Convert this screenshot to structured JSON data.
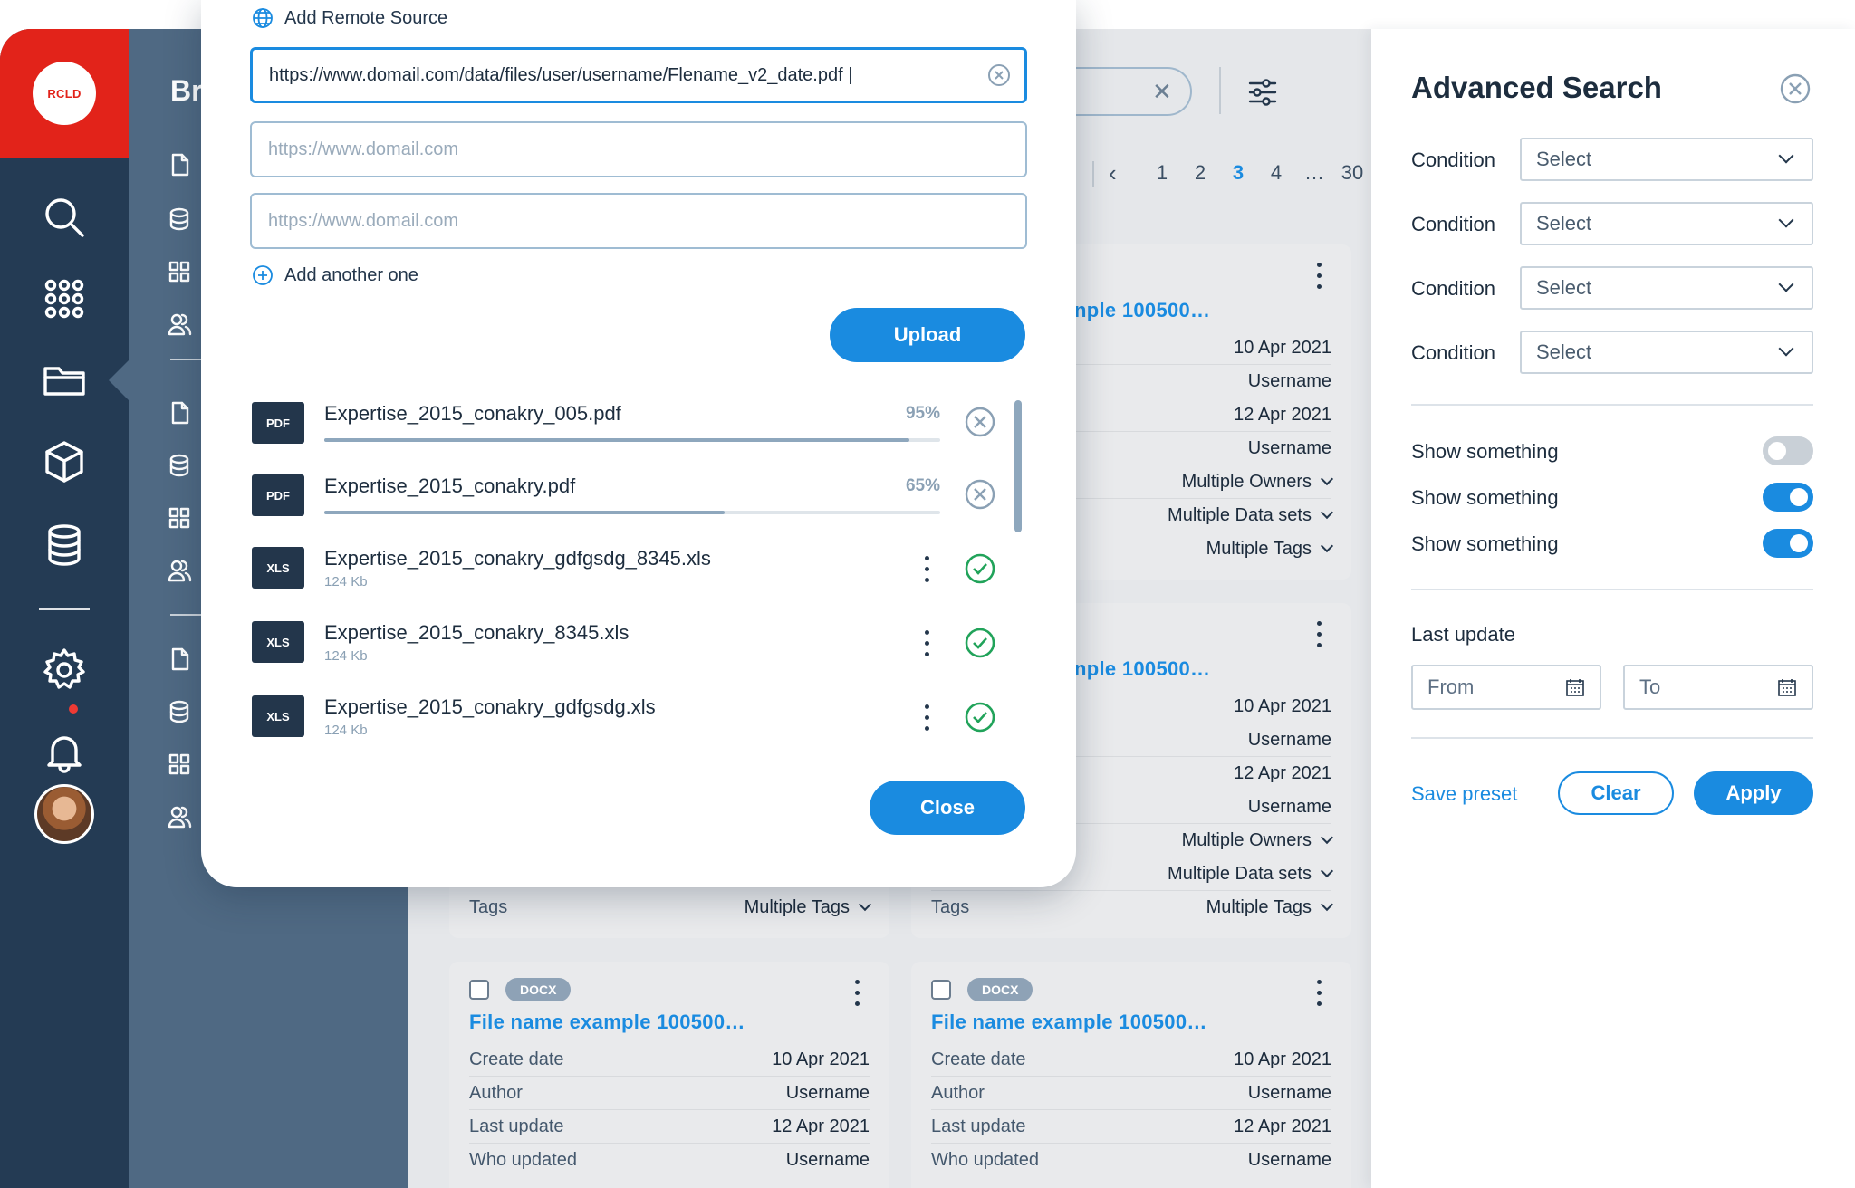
{
  "rail": {
    "logo": "RCLD",
    "items": [
      "search-icon",
      "apps-grid-icon",
      "folder-icon",
      "cube-icon",
      "database-icon",
      "settings-icon",
      "bell-icon"
    ]
  },
  "sidebar": {
    "title": "Br"
  },
  "toolbar": {
    "pager": {
      "pages": [
        "1",
        "2",
        "3",
        "4",
        "…",
        "30"
      ],
      "current": "3"
    }
  },
  "cards": [
    {
      "title_partial": "nple 100500…",
      "rows": [
        {
          "key": "",
          "value": "10 Apr 2021"
        },
        {
          "key": "",
          "value": "Username"
        },
        {
          "key": "",
          "value": "12 Apr 2021"
        },
        {
          "key": "",
          "value": "Username"
        },
        {
          "key": "",
          "value": "Multiple Owners"
        },
        {
          "key": "",
          "value": "Multiple Data sets"
        },
        {
          "key": "",
          "value": "Multiple Tags"
        }
      ]
    },
    {
      "title_partial": "nple 100500…",
      "rows": [
        {
          "key": "",
          "value": "10 Apr 2021"
        },
        {
          "key": "",
          "value": "Username"
        },
        {
          "key": "",
          "value": "12 Apr 2021"
        },
        {
          "key": "",
          "value": "Username"
        },
        {
          "key": "",
          "value": "Multiple Owners"
        },
        {
          "key": "",
          "value": "Multiple Data sets"
        },
        {
          "key": "Tags",
          "value": "Multiple Tags"
        }
      ]
    },
    {
      "tags_row": {
        "key": "Tags",
        "value": "Multiple Tags"
      }
    },
    {
      "badge": "DOCX",
      "title": "File name example 100500…",
      "rows": [
        {
          "key": "Create date",
          "value": "10 Apr 2021"
        },
        {
          "key": "Author",
          "value": "Username"
        },
        {
          "key": "Last update",
          "value": "12 Apr 2021"
        },
        {
          "key": "Who updated",
          "value": "Username"
        }
      ]
    },
    {
      "badge": "DOCX",
      "title": "File name example 100500…",
      "rows": [
        {
          "key": "Create date",
          "value": "10 Apr 2021"
        },
        {
          "key": "Author",
          "value": "Username"
        },
        {
          "key": "Last update",
          "value": "12 Apr 2021"
        },
        {
          "key": "Who updated",
          "value": "Username"
        }
      ]
    }
  ],
  "modal": {
    "add_remote_label": "Add Remote Source",
    "url_1_value": "https://www.domail.com/data/files/user/username/Flename_v2_date.pdf |",
    "url_placeholder": "https://www.domail.com",
    "add_another_label": "Add another one",
    "upload_label": "Upload",
    "close_label": "Close",
    "files": [
      {
        "type": "PDF",
        "name": "Expertise_2015_conakry_005.pdf",
        "progress": 95,
        "progress_label": "95%",
        "status": "uploading"
      },
      {
        "type": "PDF",
        "name": "Expertise_2015_conakry.pdf",
        "progress": 65,
        "progress_label": "65%",
        "status": "uploading"
      },
      {
        "type": "XLS",
        "name": "Expertise_2015_conakry_gdfgsdg_8345.xls",
        "size": "124 Kb",
        "status": "done"
      },
      {
        "type": "XLS",
        "name": "Expertise_2015_conakry_8345.xls",
        "size": "124 Kb",
        "status": "done"
      },
      {
        "type": "XLS",
        "name": "Expertise_2015_conakry_gdfgsdg.xls",
        "size": "124 Kb",
        "status": "done"
      }
    ]
  },
  "advanced_search": {
    "title": "Advanced Search",
    "conditions": [
      {
        "label": "Condition",
        "value": "Select"
      },
      {
        "label": "Condition",
        "value": "Select"
      },
      {
        "label": "Condition",
        "value": "Select"
      },
      {
        "label": "Condition",
        "value": "Select"
      }
    ],
    "toggles": [
      {
        "label": "Show something",
        "on": false
      },
      {
        "label": "Show something",
        "on": true
      },
      {
        "label": "Show something",
        "on": true
      }
    ],
    "last_update_label": "Last update",
    "from_placeholder": "From",
    "to_placeholder": "To",
    "save_preset_label": "Save preset",
    "clear_label": "Clear",
    "apply_label": "Apply"
  },
  "colors": {
    "accent": "#1a8be0",
    "rail": "#243b54",
    "sidebar": "#4f6983",
    "brand": "#e2231a",
    "success": "#21a35a"
  }
}
